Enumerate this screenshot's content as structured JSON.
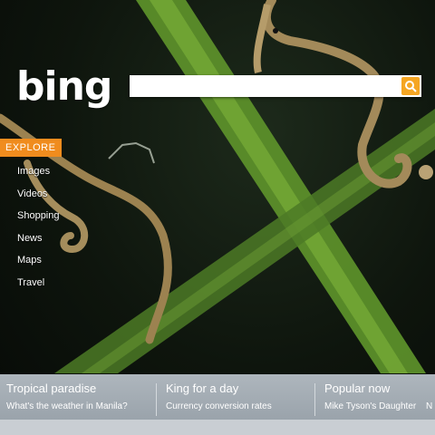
{
  "logo": {
    "text": "bing"
  },
  "search": {
    "value": "",
    "button_icon": "search-icon"
  },
  "explore": {
    "label": "EXPLORE",
    "items": [
      "Images",
      "Videos",
      "Shopping",
      "News",
      "Maps",
      "Travel"
    ]
  },
  "footer": {
    "columns": [
      {
        "title": "Tropical paradise",
        "link": "What's the weather in Manila?"
      },
      {
        "title": "King for a day",
        "link": "Currency conversion rates"
      },
      {
        "title": "Popular now",
        "link": "Mike Tyson's Daughter"
      }
    ],
    "overflow_text": "N"
  },
  "colors": {
    "accent": "#f08c1e",
    "search_button": "#f5a623",
    "footer": "#a4adb5"
  }
}
